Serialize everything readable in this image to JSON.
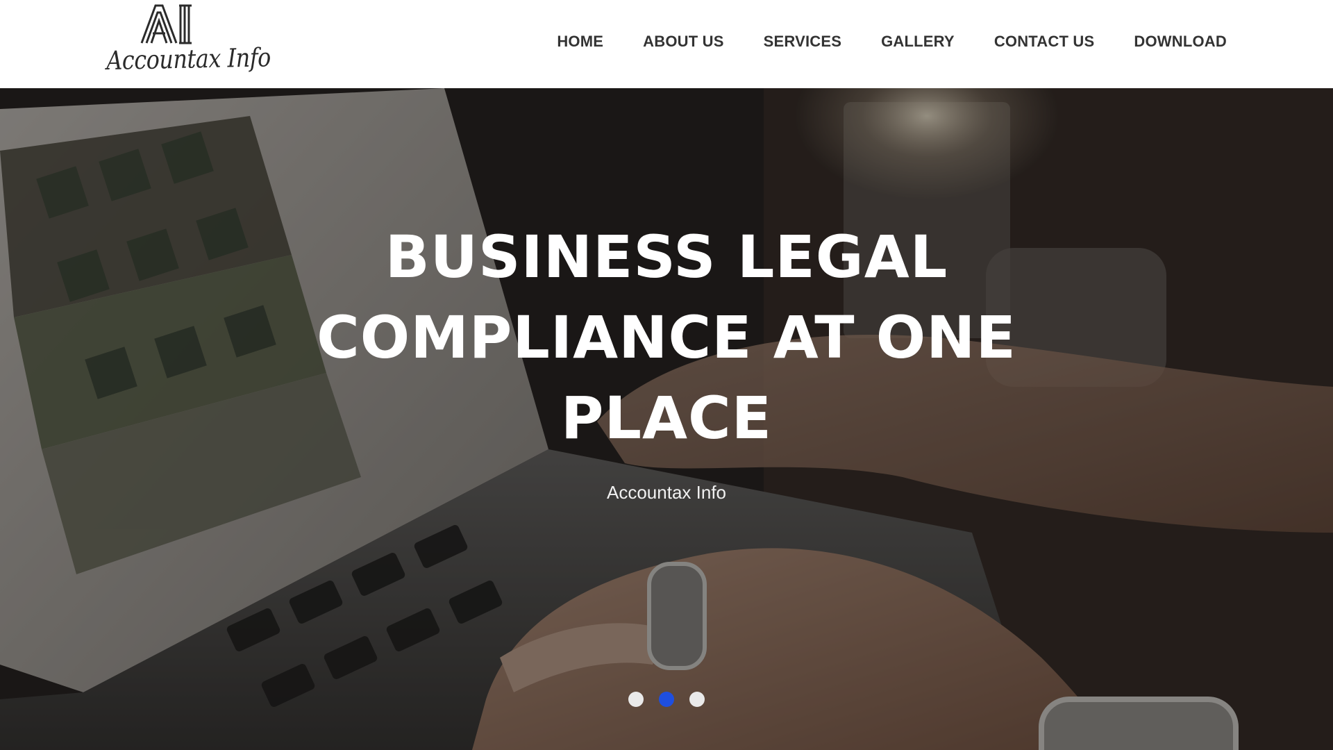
{
  "brand": {
    "logo_mark": "AI",
    "logo_text": "Accountax Info"
  },
  "nav": {
    "items": [
      {
        "label": "HOME"
      },
      {
        "label": "ABOUT US"
      },
      {
        "label": "SERVICES"
      },
      {
        "label": "GALLERY"
      },
      {
        "label": "CONTACT US"
      },
      {
        "label": "DOWNLOAD"
      }
    ]
  },
  "hero": {
    "title_lines": [
      "BUSINESS LEGAL",
      "COMPLIANCE AT ONE",
      "PLACE"
    ],
    "subtitle": "Accountax Info",
    "background_image": "laptop-typing-hands-photo",
    "slides_count": 3,
    "active_slide": 2
  },
  "colors": {
    "nav_text": "#333333",
    "dot_active": "#1e4fe0",
    "dot_inactive": "#eaeaea",
    "overlay": "#1e1b19"
  }
}
